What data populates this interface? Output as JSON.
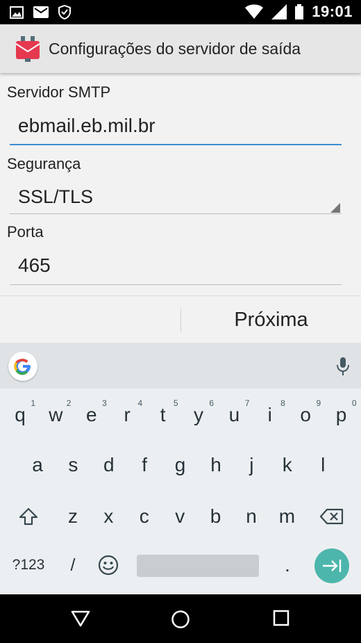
{
  "status_bar": {
    "time": "19:01",
    "left_icons": [
      "image-icon",
      "mail-icon",
      "shield-check-icon"
    ],
    "right_icons": [
      "wifi-icon",
      "signal-icon",
      "battery-icon"
    ]
  },
  "app_bar": {
    "title": "Configurações do servidor de saída",
    "icon": "email-server-icon",
    "accent": "#e53950"
  },
  "form": {
    "smtp": {
      "label": "Servidor SMTP",
      "value": "ebmail.eb.mil.br"
    },
    "security": {
      "label": "Segurança",
      "value": "SSL/TLS"
    },
    "port": {
      "label": "Porta",
      "value": "465"
    }
  },
  "next_button": {
    "label": "Próxima"
  },
  "keyboard": {
    "row1": [
      {
        "k": "q",
        "h": "1"
      },
      {
        "k": "w",
        "h": "2"
      },
      {
        "k": "e",
        "h": "3"
      },
      {
        "k": "r",
        "h": "4"
      },
      {
        "k": "t",
        "h": "5"
      },
      {
        "k": "y",
        "h": "6"
      },
      {
        "k": "u",
        "h": "7"
      },
      {
        "k": "i",
        "h": "8"
      },
      {
        "k": "o",
        "h": "9"
      },
      {
        "k": "p",
        "h": "0"
      }
    ],
    "row2": [
      "a",
      "s",
      "d",
      "f",
      "g",
      "h",
      "j",
      "k",
      "l"
    ],
    "row3": [
      "z",
      "x",
      "c",
      "v",
      "b",
      "n",
      "m"
    ],
    "symbols": "?123",
    "slash": "/",
    "period": ".",
    "enter_color": "#4db6ac"
  },
  "nav_bar": {
    "buttons": [
      "back-icon",
      "home-icon",
      "recents-icon"
    ]
  }
}
